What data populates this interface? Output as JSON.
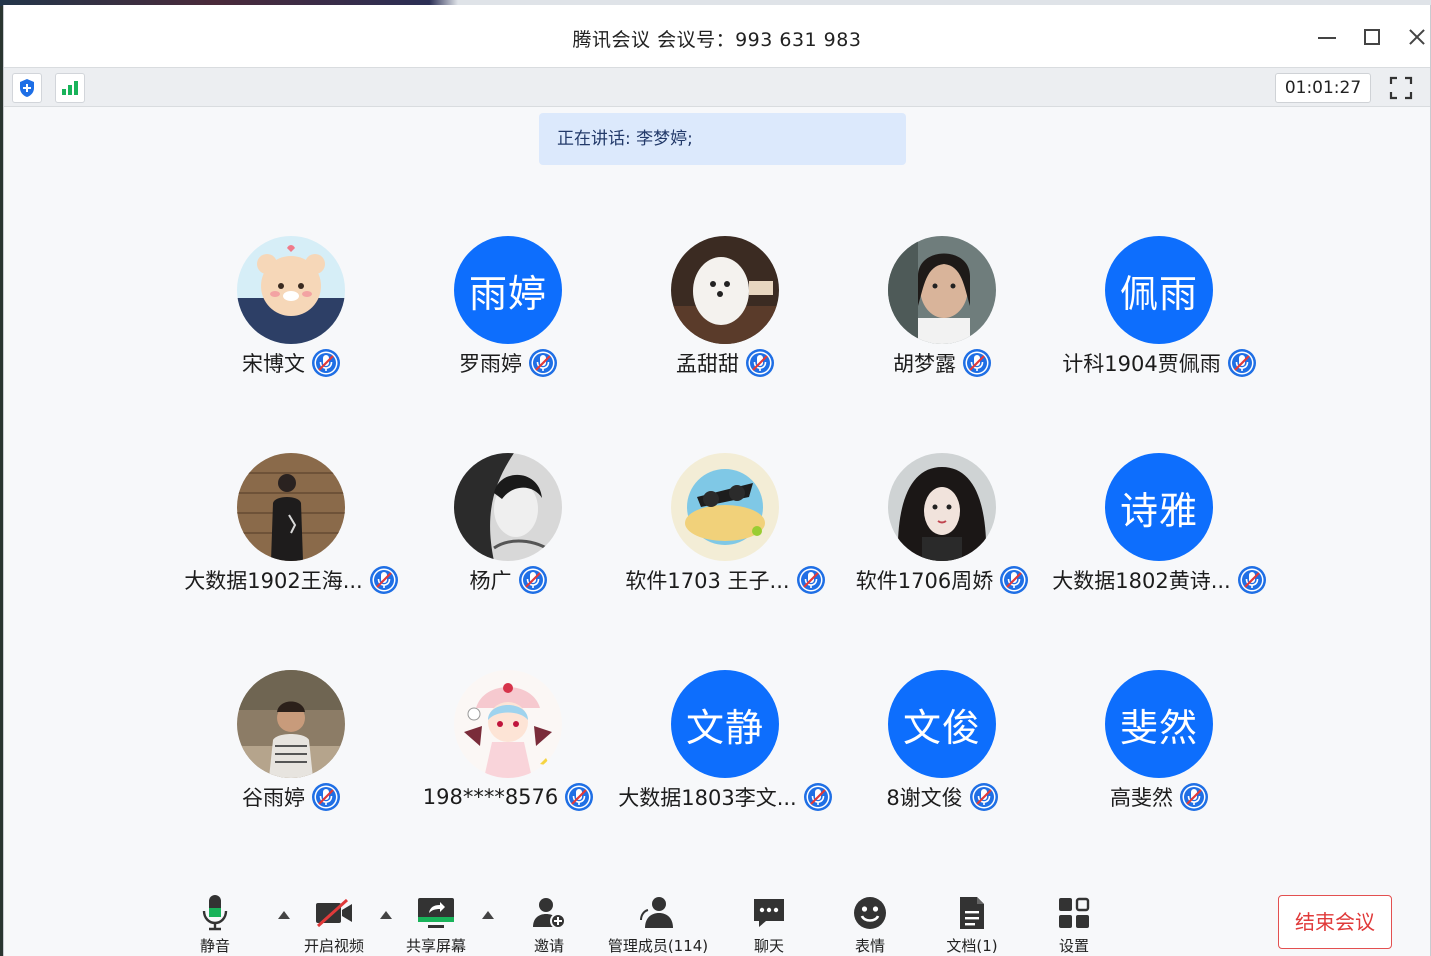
{
  "window": {
    "title": "腾讯会议 会议号：993 631 983"
  },
  "status": {
    "timer": "01:01:27"
  },
  "speaking": "正在讲话: 李梦婷;",
  "participants": [
    {
      "name": "宋博文",
      "avatar_text": ""
    },
    {
      "name": "罗雨婷",
      "avatar_text": "雨婷"
    },
    {
      "name": "孟甜甜",
      "avatar_text": ""
    },
    {
      "name": "胡梦露",
      "avatar_text": ""
    },
    {
      "name": "计科1904贾佩雨",
      "avatar_text": "佩雨"
    },
    {
      "name": "大数据1902王海...",
      "avatar_text": ""
    },
    {
      "name": "杨广",
      "avatar_text": ""
    },
    {
      "name": "软件1703 王子...",
      "avatar_text": ""
    },
    {
      "name": "软件1706周娇",
      "avatar_text": ""
    },
    {
      "name": "大数据1802黄诗...",
      "avatar_text": "诗雅"
    },
    {
      "name": "谷雨婷",
      "avatar_text": ""
    },
    {
      "name": "198****8576",
      "avatar_text": ""
    },
    {
      "name": "大数据1803李文...",
      "avatar_text": "文静"
    },
    {
      "name": "8谢文俊",
      "avatar_text": "文俊"
    },
    {
      "name": "高斐然",
      "avatar_text": "斐然"
    }
  ],
  "toolbar": {
    "mute": "静音",
    "video": "开启视频",
    "share": "共享屏幕",
    "invite": "邀请",
    "members": "管理成员(114)",
    "chat": "聊天",
    "emoji": "表情",
    "docs": "文档(1)",
    "settings": "设置",
    "end": "结束会议"
  },
  "colors": {
    "accent": "#0d6efd",
    "end": "#e03a3a",
    "signal": "#19b35a"
  }
}
